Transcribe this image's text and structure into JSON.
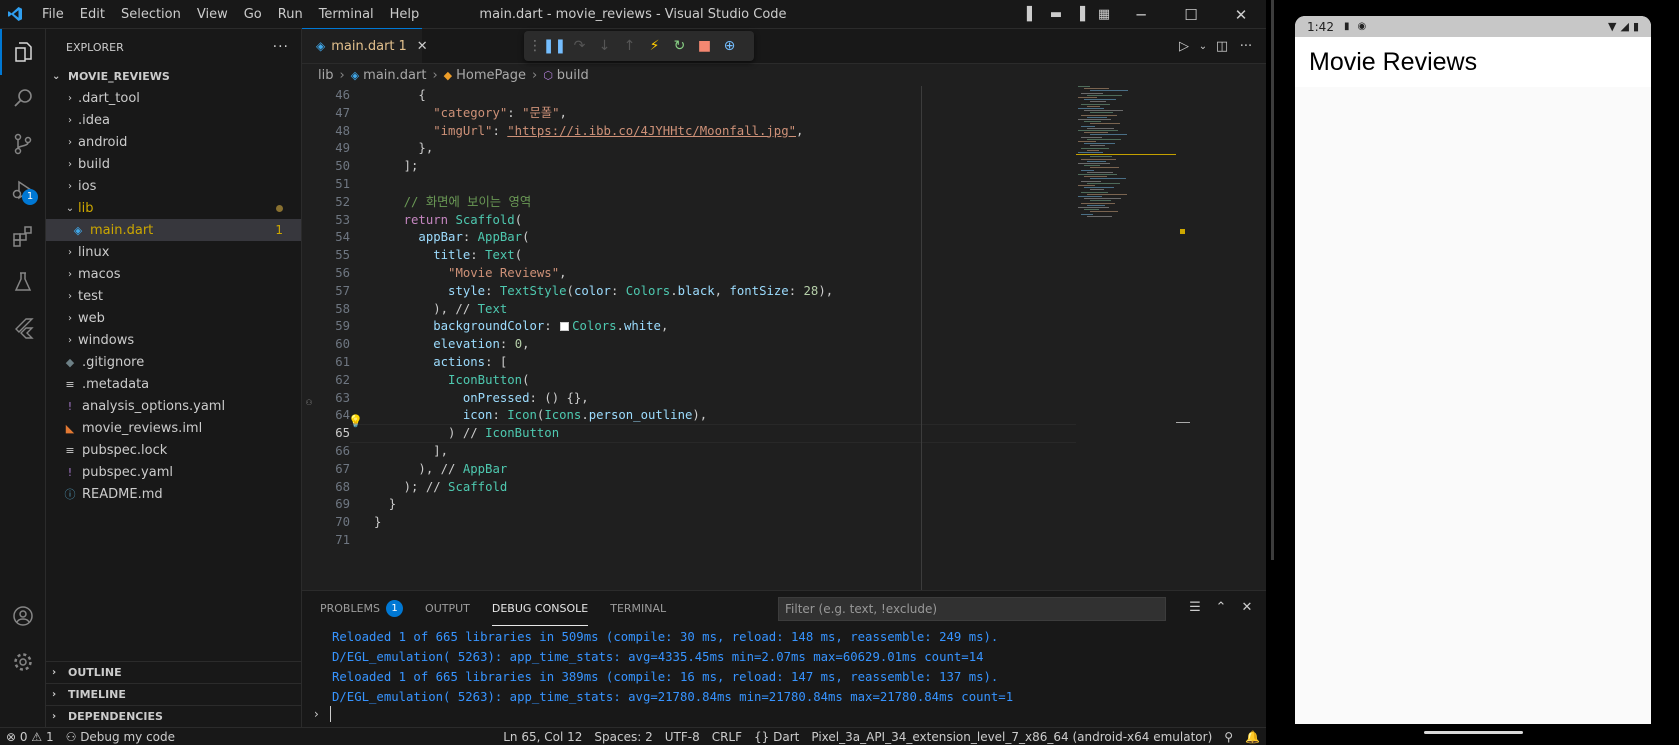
{
  "titlebar": {
    "menu": [
      "File",
      "Edit",
      "Selection",
      "View",
      "Go",
      "Run",
      "Terminal",
      "Help"
    ],
    "window_title": "main.dart - movie_reviews - Visual Studio Code"
  },
  "activity_badge": "1",
  "explorer": {
    "title": "EXPLORER",
    "root": "MOVIE_REVIEWS",
    "items": [
      {
        "label": ".dart_tool",
        "type": "folder",
        "icon": "chevron-right"
      },
      {
        "label": ".idea",
        "type": "folder",
        "icon": "chevron-right"
      },
      {
        "label": "android",
        "type": "folder",
        "icon": "chevron-right"
      },
      {
        "label": "build",
        "type": "folder",
        "icon": "chevron-right"
      },
      {
        "label": "ios",
        "type": "folder",
        "icon": "chevron-right"
      },
      {
        "label": "lib",
        "type": "folder-open",
        "icon": "chevron-down"
      },
      {
        "label": "main.dart",
        "type": "dart-file",
        "badge": "1"
      },
      {
        "label": "linux",
        "type": "folder",
        "icon": "chevron-right"
      },
      {
        "label": "macos",
        "type": "folder",
        "icon": "chevron-right"
      },
      {
        "label": "test",
        "type": "folder",
        "icon": "chevron-right"
      },
      {
        "label": "web",
        "type": "folder",
        "icon": "chevron-right"
      },
      {
        "label": "windows",
        "type": "folder",
        "icon": "chevron-right"
      },
      {
        "label": ".gitignore",
        "type": "file"
      },
      {
        "label": ".metadata",
        "type": "file"
      },
      {
        "label": "analysis_options.yaml",
        "type": "yaml-file"
      },
      {
        "label": "movie_reviews.iml",
        "type": "rss-file"
      },
      {
        "label": "pubspec.lock",
        "type": "file"
      },
      {
        "label": "pubspec.yaml",
        "type": "yaml-file"
      },
      {
        "label": "README.md",
        "type": "info-file"
      }
    ],
    "sections": [
      "OUTLINE",
      "TIMELINE",
      "DEPENDENCIES"
    ]
  },
  "editor": {
    "tab_label": "main.dart",
    "tab_problems": "1",
    "breadcrumb": [
      "lib",
      "main.dart",
      "HomePage",
      "build"
    ],
    "current_line": 65,
    "lines": [
      {
        "n": "46",
        "t": "      {"
      },
      {
        "n": "47",
        "t": "        \"category\": \"문폴\","
      },
      {
        "n": "48",
        "t": "        \"imgUrl\": \"https://i.ibb.co/4JYHHtc/Moonfall.jpg\","
      },
      {
        "n": "49",
        "t": "      },"
      },
      {
        "n": "50",
        "t": "    ];"
      },
      {
        "n": "51",
        "t": ""
      },
      {
        "n": "52",
        "t": "    // 화면에 보이는 영역"
      },
      {
        "n": "53",
        "t": "    return Scaffold("
      },
      {
        "n": "54",
        "t": "      appBar: AppBar("
      },
      {
        "n": "55",
        "t": "        title: Text("
      },
      {
        "n": "56",
        "t": "          \"Movie Reviews\","
      },
      {
        "n": "57",
        "t": "          style: TextStyle(color: Colors.black, fontSize: 28),"
      },
      {
        "n": "58",
        "t": "        ), // Text"
      },
      {
        "n": "59",
        "t": "        backgroundColor: Colors.white,"
      },
      {
        "n": "60",
        "t": "        elevation: 0,"
      },
      {
        "n": "61",
        "t": "        actions: ["
      },
      {
        "n": "62",
        "t": "          IconButton("
      },
      {
        "n": "63",
        "t": "            onPressed: () {},"
      },
      {
        "n": "64",
        "t": "            icon: Icon(Icons.person_outline),"
      },
      {
        "n": "65",
        "t": "          ) // IconButton"
      },
      {
        "n": "66",
        "t": "        ],"
      },
      {
        "n": "67",
        "t": "      ), // AppBar"
      },
      {
        "n": "68",
        "t": "    ); // Scaffold"
      },
      {
        "n": "69",
        "t": "  }"
      },
      {
        "n": "70",
        "t": "}"
      },
      {
        "n": "71",
        "t": ""
      }
    ]
  },
  "panel": {
    "tabs": [
      "PROBLEMS",
      "OUTPUT",
      "DEBUG CONSOLE",
      "TERMINAL"
    ],
    "problems_count": "1",
    "active_tab": "DEBUG CONSOLE",
    "filter_placeholder": "Filter (e.g. text, !exclude)",
    "lines": [
      {
        "text": "Reloaded 1 of 665 libraries in 509ms (compile: 30 ms, reload: 148 ms, reassemble: 249 ms).",
        "color": "#3794ff"
      },
      {
        "text": "D/EGL_emulation( 5263): app_time_stats: avg=4335.45ms min=2.07ms max=60629.01ms count=14",
        "color": "#3794ff"
      },
      {
        "text": "Reloaded 1 of 665 libraries in 389ms (compile: 16 ms, reload: 147 ms, reassemble: 137 ms).",
        "color": "#3794ff"
      },
      {
        "text": "D/EGL_emulation( 5263): app_time_stats: avg=21780.84ms min=21780.84ms max=21780.84ms count=1",
        "color": "#3794ff"
      }
    ]
  },
  "statusbar": {
    "errors": "0",
    "warnings": "1",
    "debug": "Debug my code",
    "position": "Ln 65, Col 12",
    "spaces": "Spaces: 2",
    "encoding": "UTF-8",
    "eol": "CRLF",
    "language": "Dart",
    "device": "Pixel_3a_API_34_extension_level_7_x86_64 (android-x64 emulator)"
  },
  "emulator": {
    "time": "1:42",
    "app_title": "Movie Reviews"
  }
}
